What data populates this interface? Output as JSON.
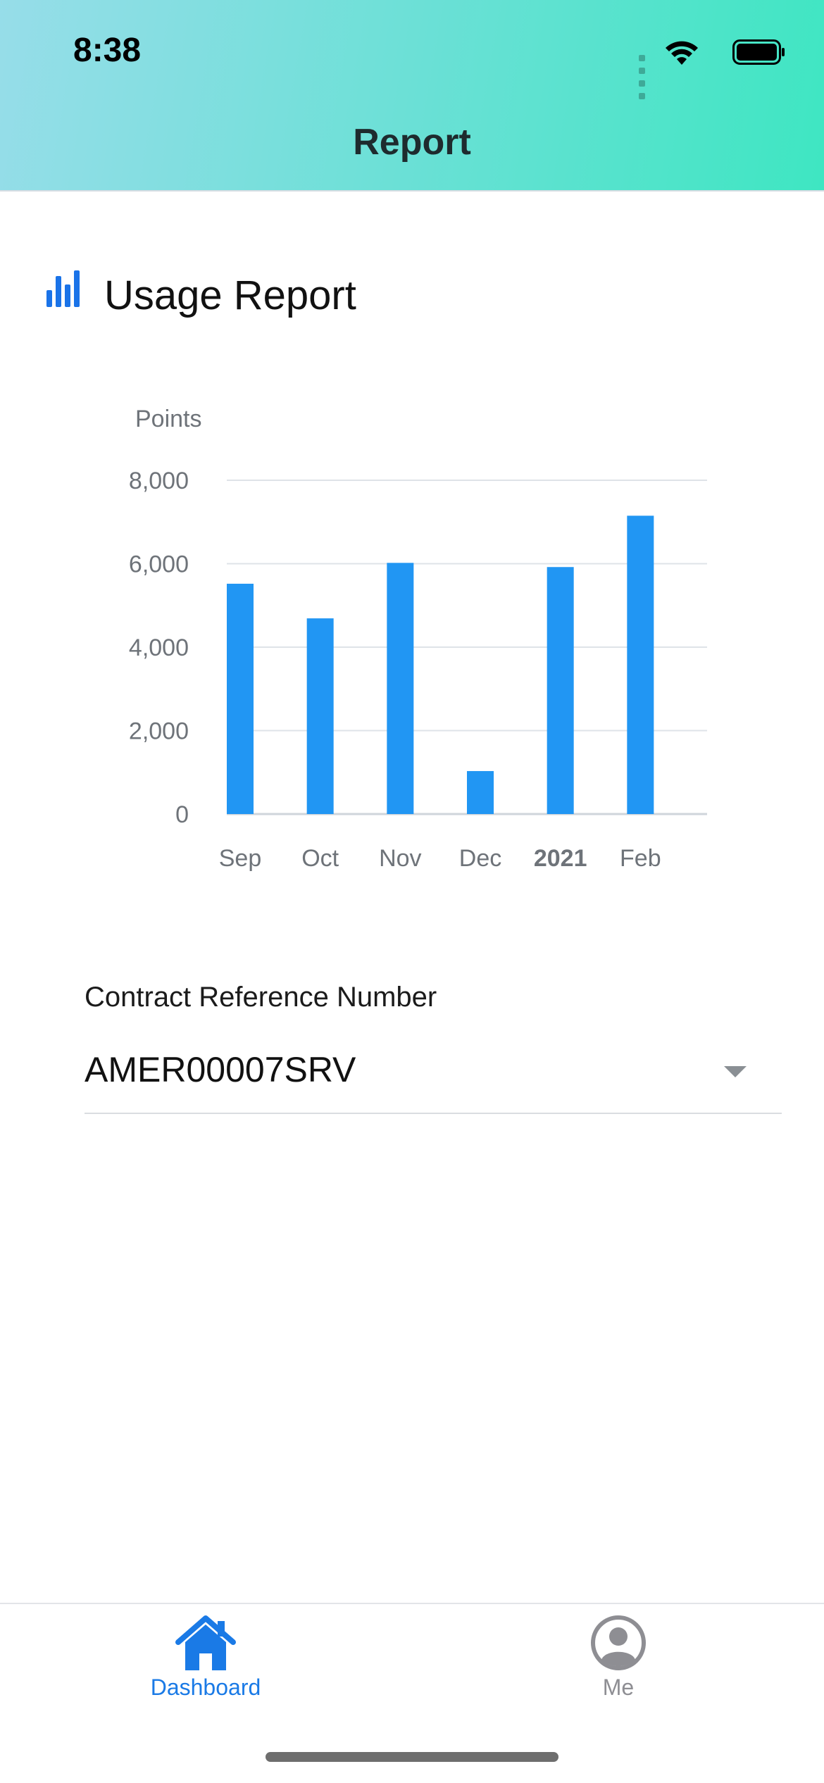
{
  "status_bar": {
    "time": "8:38"
  },
  "nav": {
    "title": "Report"
  },
  "section": {
    "title": "Usage Report",
    "icon": "bar-chart-icon"
  },
  "chart_data": {
    "type": "bar",
    "ylabel": "Points",
    "xlabel": "",
    "categories": [
      "Sep",
      "Oct",
      "Nov",
      "Dec",
      "2021",
      "Feb"
    ],
    "values": [
      5520,
      4690,
      6020,
      1030,
      5920,
      7150
    ],
    "ylim": [
      0,
      8000
    ],
    "yticks": [
      "0",
      "2,000",
      "4,000",
      "6,000",
      "8,000"
    ],
    "ytick_values": [
      0,
      2000,
      4000,
      6000,
      8000
    ],
    "grid": true,
    "bar_color": "#2196f3"
  },
  "contract": {
    "label": "Contract Reference Number",
    "value": "AMER00007SRV"
  },
  "tabbar": {
    "dashboard_label": "Dashboard",
    "me_label": "Me",
    "active_color": "#1a7ae6",
    "inactive_color": "#8e8e93"
  }
}
